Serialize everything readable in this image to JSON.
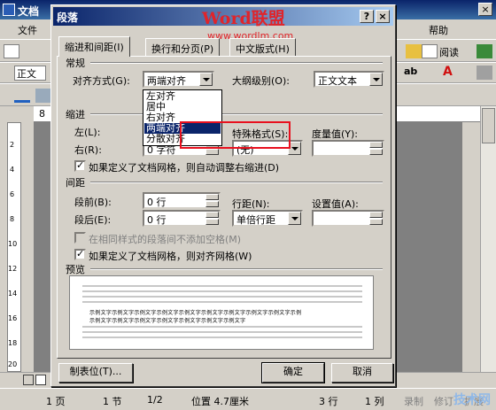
{
  "word": {
    "title": "文档",
    "menu": [
      "文件",
      "帮助"
    ],
    "toolbar": {
      "style_value": "正文 +",
      "read_label": "阅读"
    },
    "ruler_mark": "8",
    "status": [
      "1 页",
      "1 节",
      "1/2",
      "位置 4.7厘米",
      "3 行",
      "1 列",
      "录制",
      "修订",
      "扩展"
    ],
    "vruler_marks": [
      "2",
      "4",
      "6",
      "8",
      "10",
      "12",
      "14",
      "16",
      "18",
      "20"
    ]
  },
  "dialog": {
    "title": "段落",
    "help_btn": "?",
    "close_btn": "×",
    "watermark_brand": "Word联盟",
    "watermark_url": "www.wordlm.com",
    "tabs": [
      "缩进和间距(I)",
      "换行和分页(P)",
      "中文版式(H)"
    ],
    "general": {
      "heading": "常规",
      "align_label": "对齐方式(G):",
      "align_value": "两端对齐",
      "outline_label": "大纲级别(O):",
      "outline_value": "正文文本",
      "align_options": [
        "左对齐",
        "居中",
        "右对齐",
        "两端对齐",
        "分散对齐"
      ],
      "align_selected_index": 3
    },
    "indent": {
      "heading": "缩进",
      "left_label": "左(L):",
      "right_label": "右(R):",
      "right_value": "0 字符",
      "special_label": "特殊格式(S):",
      "special_value": "(无)",
      "measure_label": "度量值(Y):",
      "grid_check_label": "如果定义了文档网格，则自动调整右缩进(D)",
      "grid_checked": true
    },
    "spacing": {
      "heading": "间距",
      "before_label": "段前(B):",
      "before_value": "0 行",
      "after_label": "段后(E):",
      "after_value": "0 行",
      "line_label": "行距(N):",
      "line_value": "单倍行距",
      "setting_label": "设置值(A):",
      "nospace_label": "在相同样式的段落间不添加空格(M)",
      "nospace_checked": false,
      "snap_label": "如果定义了文档网格，则对齐网格(W)",
      "snap_checked": true
    },
    "preview": {
      "heading": "预览",
      "sample_line1": "示例文字示例文字示例文字示例文字示例文字示例文字示例文字示例文字示例文字示例",
      "sample_line2": "示例文字示例文字示例文字示例文字示例文字示例文字示例文字"
    },
    "buttons": {
      "tabs": "制表位(T)...",
      "ok": "确定",
      "cancel": "取消"
    }
  },
  "site_logo": "技术网"
}
